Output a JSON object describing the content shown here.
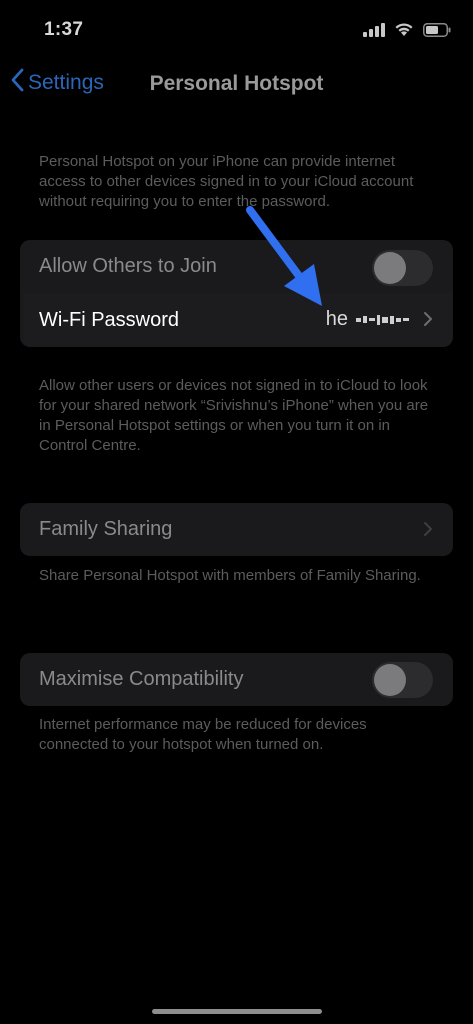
{
  "status_bar": {
    "time": "1:37",
    "icons": [
      "cellular-signal-icon",
      "wifi-icon",
      "battery-icon"
    ]
  },
  "nav": {
    "back_label": "Settings",
    "title": "Personal Hotspot",
    "accent_color": "#2a66b9"
  },
  "intro_text": "Personal Hotspot on your iPhone can provide internet access to other devices signed in to your iCloud account without requiring you to enter the password.",
  "allow_others": {
    "label": "Allow Others to Join",
    "enabled": false
  },
  "wifi_password": {
    "label": "Wi-Fi Password",
    "value_visible": "he"
  },
  "allow_footer": "Allow other users or devices not signed in to iCloud to look for your shared network “Srivishnu’s iPhone” when you are in Personal Hotspot settings or when you turn it on in Control Centre.",
  "family_sharing": {
    "label": "Family Sharing",
    "footer": "Share Personal Hotspot with members of Family Sharing."
  },
  "maximise": {
    "label": "Maximise Compatibility",
    "enabled": false,
    "footer": "Internet performance may be reduced for devices connected to your hotspot when turned on."
  },
  "annotation_arrow_color": "#2f6ff0"
}
